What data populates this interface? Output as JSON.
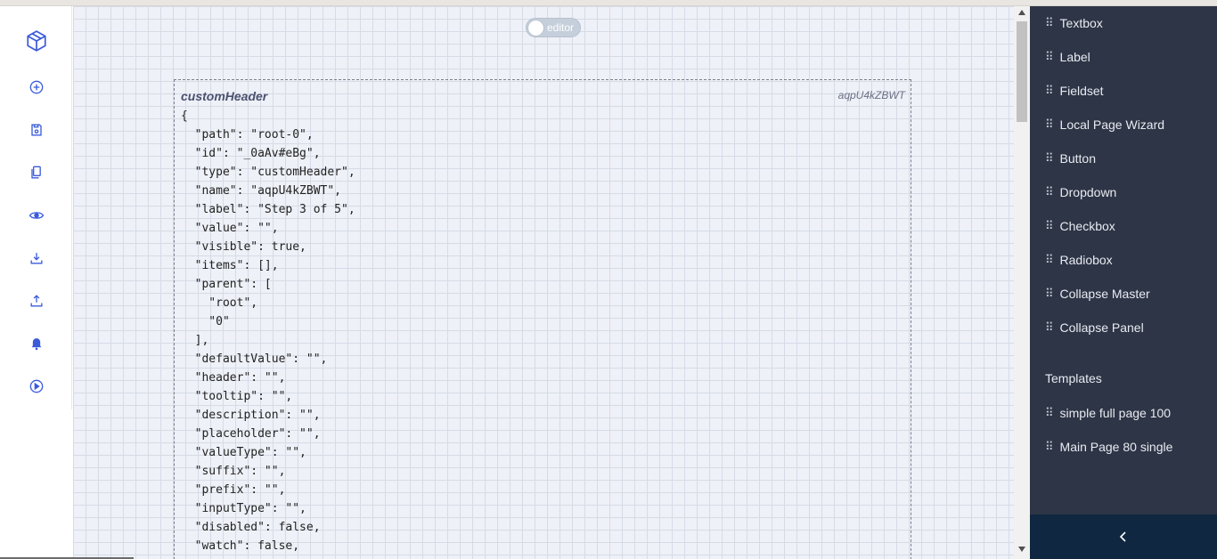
{
  "colors": {
    "rail_icon": "#3b5bdb",
    "panel_bg": "#2e3546",
    "collapse_bg": "#0f2740"
  },
  "left_rail": {
    "icons": [
      "cube-logo-icon",
      "add-circle-icon",
      "save-icon",
      "copy-icon",
      "eye-icon",
      "download-icon",
      "upload-icon",
      "bell-icon",
      "play-circle-icon"
    ]
  },
  "canvas": {
    "editor_toggle": {
      "label": "editor",
      "on": false
    },
    "component": {
      "type_label": "customHeader",
      "name_label": "aqpU4kZBWT",
      "json_lines": [
        "{",
        "  \"path\": \"root-0\",",
        "  \"id\": \"_0aAv#eBg\",",
        "  \"type\": \"customHeader\",",
        "  \"name\": \"aqpU4kZBWT\",",
        "  \"label\": \"Step 3 of 5\",",
        "  \"value\": \"\",",
        "  \"visible\": true,",
        "  \"items\": [],",
        "  \"parent\": [",
        "    \"root\",",
        "    \"0\"",
        "  ],",
        "  \"defaultValue\": \"\",",
        "  \"header\": \"\",",
        "  \"tooltip\": \"\",",
        "  \"description\": \"\",",
        "  \"placeholder\": \"\",",
        "  \"valueType\": \"\",",
        "  \"suffix\": \"\",",
        "  \"prefix\": \"\",",
        "  \"inputType\": \"\",",
        "  \"disabled\": false,",
        "  \"watch\": false,"
      ]
    }
  },
  "palette": {
    "items": [
      "Textbox",
      "Label",
      "Fieldset",
      "Local Page Wizard",
      "Button",
      "Dropdown",
      "Checkbox",
      "Radiobox",
      "Collapse Master",
      "Collapse Panel"
    ],
    "templates_heading": "Templates",
    "templates": [
      "simple full page 100",
      "Main Page 80 single"
    ],
    "drag_handle": "⠿"
  }
}
